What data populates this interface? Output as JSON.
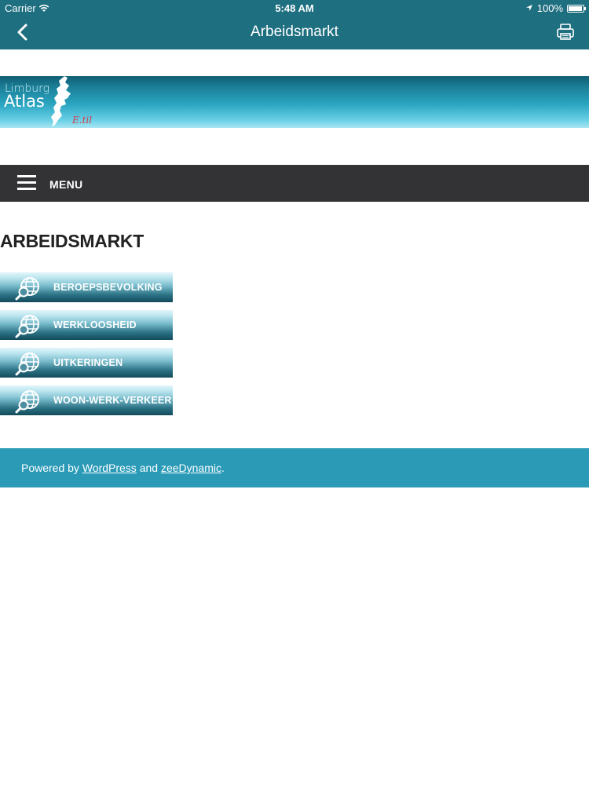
{
  "status_bar": {
    "carrier": "Carrier",
    "time": "5:48 AM",
    "battery": "100%"
  },
  "nav_bar": {
    "title": "Arbeidsmarkt"
  },
  "banner": {
    "logo_line1": "Limburg",
    "logo_line2": "Atlas",
    "logo_suffix": "E.til"
  },
  "menu": {
    "label": "MENU"
  },
  "page": {
    "title": "ARBEIDSMARKT"
  },
  "buttons": [
    {
      "label": "BEROEPSBEVOLKING",
      "icon": "globe-search-icon"
    },
    {
      "label": "WERKLOOSHEID",
      "icon": "globe-search-icon"
    },
    {
      "label": "UITKERINGEN",
      "icon": "globe-search-icon"
    },
    {
      "label": "WOON-WERK-VERKEER",
      "icon": "globe-search-icon"
    }
  ],
  "footer": {
    "prefix": "Powered by",
    "link1": "WordPress",
    "middle": "and",
    "link2": "zeeDynamic",
    "suffix": "."
  },
  "colors": {
    "nav_bar": "#1e6f80",
    "menu_bar": "#333235",
    "footer": "#2a9ab7",
    "accent_red": "#d33a4a"
  }
}
